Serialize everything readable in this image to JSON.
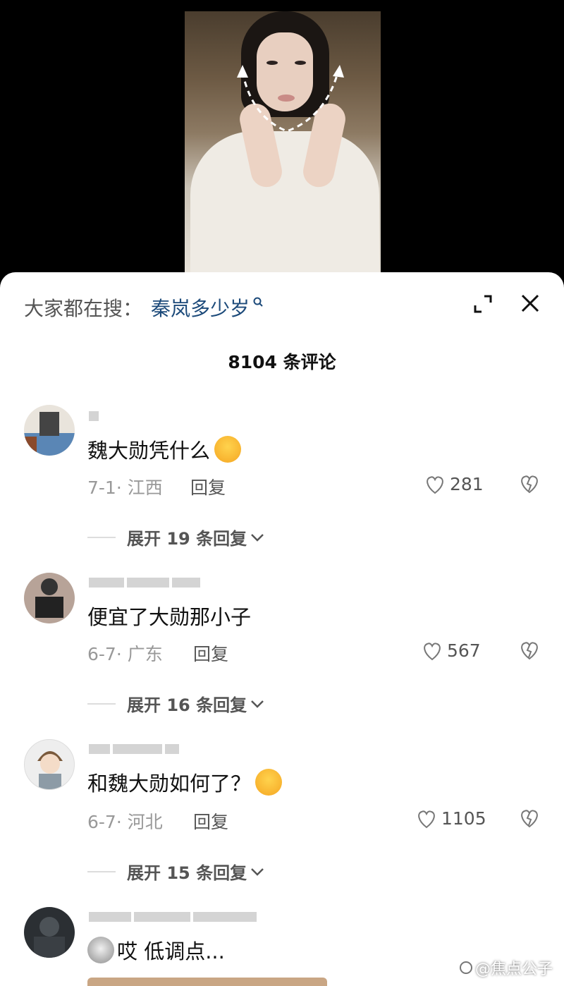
{
  "search": {
    "prefix": "大家都在搜：",
    "term": "秦岚多少岁"
  },
  "comments_header": {
    "title": "8104 条评论"
  },
  "comments": [
    {
      "text": "魏大勋凭什么",
      "emoji": "crying-face",
      "date": "7-1",
      "location": "江西",
      "reply_label": "回复",
      "likes": "281",
      "expand_label": "展开 19 条回复"
    },
    {
      "text": "便宜了大勋那小子",
      "date": "6-7",
      "location": "广东",
      "reply_label": "回复",
      "likes": "567",
      "expand_label": "展开 16 条回复"
    },
    {
      "text": "和魏大勋如何了？",
      "emoji": "laughing-tears-face",
      "date": "6-7",
      "location": "河北",
      "reply_label": "回复",
      "likes": "1105",
      "expand_label": "展开 15 条回复"
    },
    {
      "text": "哎 低调点...",
      "emoji": "dog-face"
    }
  ],
  "watermark": "@焦点公子",
  "colors": {
    "accent": "#1c4a7a",
    "sheet_bg": "#ffffff",
    "muted": "#999999"
  }
}
